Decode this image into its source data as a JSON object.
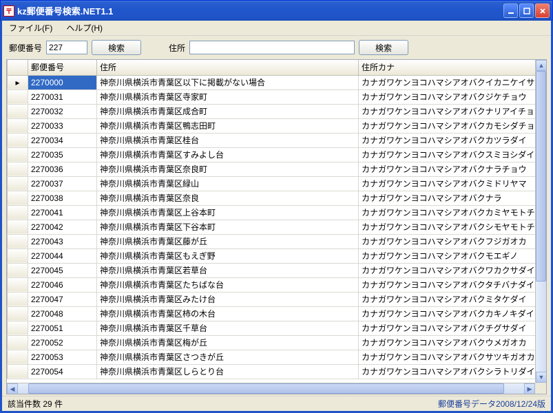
{
  "window": {
    "title": "kz郵便番号検索.NET1.1"
  },
  "menus": {
    "file": "ファイル(F)",
    "help": "ヘルプ(H)"
  },
  "toolbar": {
    "zip_label": "郵便番号",
    "zip_value": "227",
    "search_btn": "検索",
    "addr_label": "住所",
    "addr_value": ""
  },
  "grid": {
    "headers": {
      "zip": "郵便番号",
      "addr": "住所",
      "kana": "住所カナ"
    },
    "selected_index": 0,
    "rows": [
      {
        "zip": "2270000",
        "addr": "神奈川県横浜市青葉区以下に掲載がない場合",
        "kana": "カナガワケンヨコハマシアオバクイカニケイサ"
      },
      {
        "zip": "2270031",
        "addr": "神奈川県横浜市青葉区寺家町",
        "kana": "カナガワケンヨコハマシアオバクジケチョウ"
      },
      {
        "zip": "2270032",
        "addr": "神奈川県横浜市青葉区成合町",
        "kana": "カナガワケンヨコハマシアオバクナリアイチョウ"
      },
      {
        "zip": "2270033",
        "addr": "神奈川県横浜市青葉区鴨志田町",
        "kana": "カナガワケンヨコハマシアオバクカモシダチョ"
      },
      {
        "zip": "2270034",
        "addr": "神奈川県横浜市青葉区桂台",
        "kana": "カナガワケンヨコハマシアオバクカツラダイ"
      },
      {
        "zip": "2270035",
        "addr": "神奈川県横浜市青葉区すみよし台",
        "kana": "カナガワケンヨコハマシアオバクスミヨシダイ"
      },
      {
        "zip": "2270036",
        "addr": "神奈川県横浜市青葉区奈良町",
        "kana": "カナガワケンヨコハマシアオバクナラチョウ"
      },
      {
        "zip": "2270037",
        "addr": "神奈川県横浜市青葉区緑山",
        "kana": "カナガワケンヨコハマシアオバクミドリヤマ"
      },
      {
        "zip": "2270038",
        "addr": "神奈川県横浜市青葉区奈良",
        "kana": "カナガワケンヨコハマシアオバクナラ"
      },
      {
        "zip": "2270041",
        "addr": "神奈川県横浜市青葉区上谷本町",
        "kana": "カナガワケンヨコハマシアオバクカミヤモトチョ"
      },
      {
        "zip": "2270042",
        "addr": "神奈川県横浜市青葉区下谷本町",
        "kana": "カナガワケンヨコハマシアオバクシモヤモトチョ"
      },
      {
        "zip": "2270043",
        "addr": "神奈川県横浜市青葉区藤が丘",
        "kana": "カナガワケンヨコハマシアオバクフジガオカ"
      },
      {
        "zip": "2270044",
        "addr": "神奈川県横浜市青葉区もえぎ野",
        "kana": "カナガワケンヨコハマシアオバクモエギノ"
      },
      {
        "zip": "2270045",
        "addr": "神奈川県横浜市青葉区若草台",
        "kana": "カナガワケンヨコハマシアオバクワカクサダイ"
      },
      {
        "zip": "2270046",
        "addr": "神奈川県横浜市青葉区たちばな台",
        "kana": "カナガワケンヨコハマシアオバクタチバナダイ"
      },
      {
        "zip": "2270047",
        "addr": "神奈川県横浜市青葉区みたけ台",
        "kana": "カナガワケンヨコハマシアオバクミタケダイ"
      },
      {
        "zip": "2270048",
        "addr": "神奈川県横浜市青葉区柿の木台",
        "kana": "カナガワケンヨコハマシアオバクカキノキダイ"
      },
      {
        "zip": "2270051",
        "addr": "神奈川県横浜市青葉区千草台",
        "kana": "カナガワケンヨコハマシアオバクチグサダイ"
      },
      {
        "zip": "2270052",
        "addr": "神奈川県横浜市青葉区梅が丘",
        "kana": "カナガワケンヨコハマシアオバクウメガオカ"
      },
      {
        "zip": "2270053",
        "addr": "神奈川県横浜市青葉区さつきが丘",
        "kana": "カナガワケンヨコハマシアオバクサツキガオカ"
      },
      {
        "zip": "2270054",
        "addr": "神奈川県横浜市青葉区しらとり台",
        "kana": "カナガワケンヨコハマシアオバクシラトリダイ"
      }
    ]
  },
  "status": {
    "count_label": "該当件数 29 件",
    "version": "郵便番号データ2008/12/24版"
  }
}
